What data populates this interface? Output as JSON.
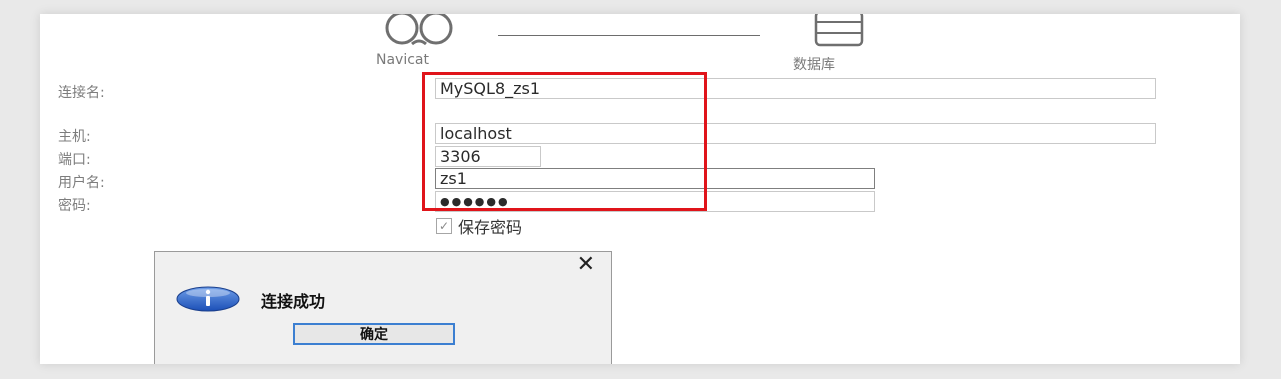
{
  "header": {
    "left_label": "Navicat",
    "right_label": "数据库"
  },
  "form": {
    "connection_name_label": "连接名:",
    "connection_name_value": "MySQL8_zs1",
    "host_label": "主机:",
    "host_value": "localhost",
    "port_label": "端口:",
    "port_value": "3306",
    "username_label": "用户名:",
    "username_value": "zs1",
    "password_label": "密码:",
    "password_value": "●●●●●●",
    "save_password_label": "保存密码",
    "save_password_checked": true
  },
  "dialog": {
    "close_glyph": "✕",
    "message": "连接成功",
    "ok_label": "确定"
  },
  "colors": {
    "highlight": "#e0141a",
    "ok_border": "#3c7fd1",
    "info_blue": "#1f58c6"
  }
}
